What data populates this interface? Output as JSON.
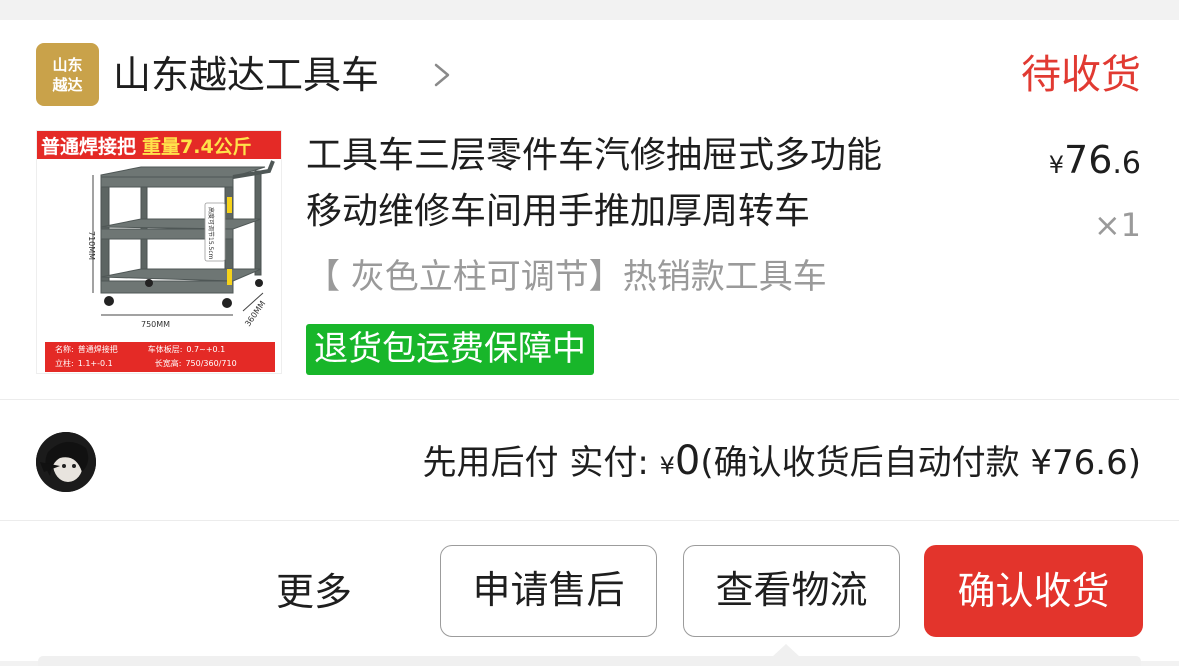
{
  "shop": {
    "logo_text_line1": "山东",
    "logo_text_line2": "越达",
    "name": "山东越达工具车",
    "chevron": "chevron-right-icon"
  },
  "order": {
    "status": "待收货",
    "status_color": "#e13a32"
  },
  "product": {
    "thumb_banner_left": "普通焊接把",
    "thumb_banner_right": "重量7.4公斤",
    "thumb_labels": {
      "height_note": "高度可调节15.5cm",
      "dim_height": "710MM",
      "dim_width": "750MM",
      "dim_depth": "360MM"
    },
    "thumb_specs": {
      "name_key": "名称:",
      "name_val": "普通焊接把",
      "board_key": "车体板层:",
      "board_val": "0.7~+0.1",
      "pillar_key": "立柱:",
      "pillar_val": "1.1+-0.1",
      "size_key": "长宽高:",
      "size_val": "750/360/710"
    },
    "title_line1": "工具车三层零件车汽修抽屉式多功能",
    "title_line2": "移动维修车间用手推加厚周转车",
    "sku": "【 灰色立柱可调节】热销款工具车",
    "guarantee": "退货包运费保障中",
    "guarantee_color": "#18b62a",
    "price_currency": "¥",
    "price_int": "76",
    "price_dec": ".6",
    "quantity": "×1"
  },
  "payment": {
    "label": "先用后付 实付:",
    "currency": "¥",
    "amount": "0",
    "note": "(确认收货后自动付款 ¥76.6)"
  },
  "actions": {
    "more": "更多",
    "after_sale": "申请售后",
    "logistics": "查看物流",
    "confirm": "确认收货",
    "confirm_color": "#e3342c"
  }
}
